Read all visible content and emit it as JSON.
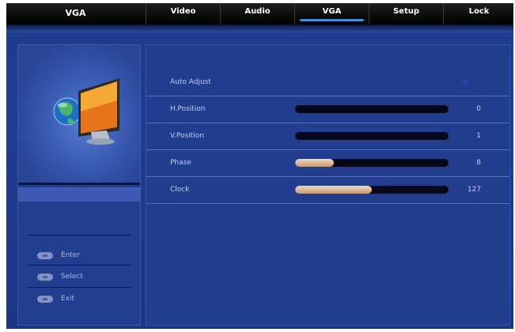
{
  "header": {
    "section_title": "VGA",
    "tabs": [
      {
        "label": "Video",
        "active": false
      },
      {
        "label": "Audio",
        "active": false
      },
      {
        "label": "VGA",
        "active": true
      },
      {
        "label": "Setup",
        "active": false
      },
      {
        "label": "Lock",
        "active": false
      }
    ]
  },
  "sidebar": {
    "icon": "monitor-globe-icon",
    "hints": [
      {
        "icon": "enter-key-icon",
        "label": "Enter"
      },
      {
        "icon": "select-key-icon",
        "label": "Select"
      },
      {
        "icon": "exit-key-icon",
        "label": "Exit"
      }
    ]
  },
  "settings": [
    {
      "label": "Auto Adjust",
      "type": "toggle"
    },
    {
      "label": "H.Position",
      "type": "slider",
      "value": "0",
      "fraction": 0.0
    },
    {
      "label": "V.Position",
      "type": "slider",
      "value": "1",
      "fraction": 0.0
    },
    {
      "label": "Phase",
      "type": "slider",
      "value": "8",
      "fraction": 0.25
    },
    {
      "label": "Clock",
      "type": "slider",
      "value": "127",
      "fraction": 0.5
    }
  ],
  "colors": {
    "background": "#213c8d",
    "accent": "#3d8fd8",
    "slider_fill": "#d9b394",
    "slider_track": "#06091c"
  }
}
